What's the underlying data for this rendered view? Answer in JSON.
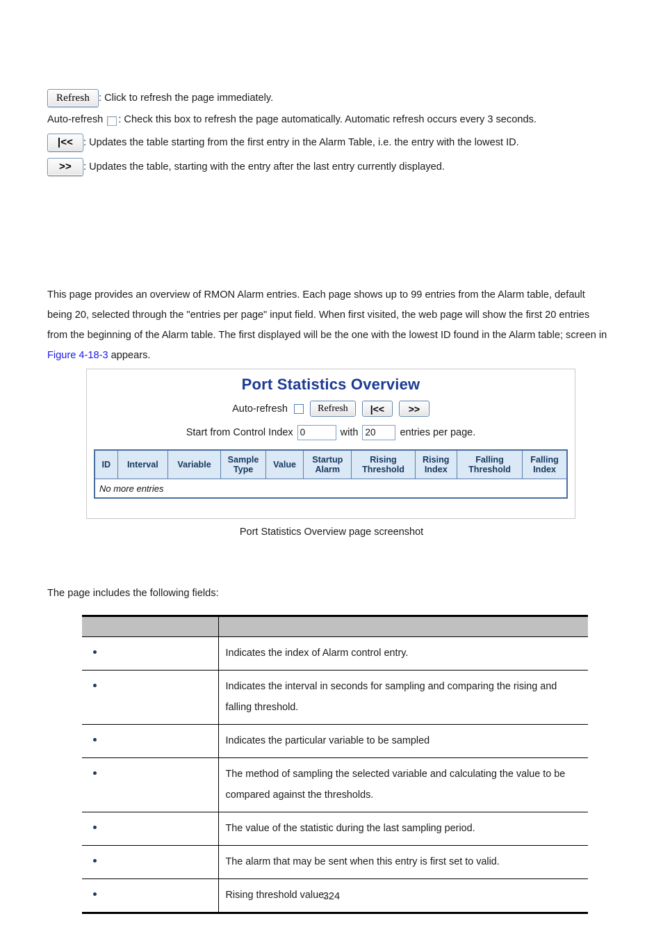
{
  "legend": {
    "refresh_button_label": "Refresh",
    "refresh_desc": ": Click to refresh the page immediately.",
    "autorefresh_label": "Auto-refresh",
    "autorefresh_desc": ": Check this box to refresh the page automatically. Automatic refresh occurs every 3 seconds.",
    "first_button_label": "|<<",
    "first_desc": ": Updates the table starting from the first entry in the Alarm Table, i.e. the entry with the lowest ID.",
    "next_button_label": ">>",
    "next_desc": ": Updates the table, starting with the entry after the last entry currently displayed."
  },
  "paragraph": {
    "part1": "This page provides an overview of RMON Alarm entries. Each page shows up to 99 entries from the Alarm table, default being 20, selected through the \"entries per page\" input field. When first visited, the web page will show the first 20 entries from the beginning of the Alarm table. The first displayed will be the one with the lowest ID found in the Alarm table; screen in ",
    "link": "Figure 4-18-3",
    "part2": " appears."
  },
  "screenshot": {
    "title": "Port Statistics Overview",
    "autorefresh_label": "Auto-refresh",
    "refresh_button": "Refresh",
    "first_button": "|<<",
    "next_button": ">>",
    "start_label": "Start from Control Index",
    "start_value": "0",
    "with_label": "with",
    "entries_value": "20",
    "entries_label": "entries per page.",
    "columns": [
      "ID",
      "Interval",
      "Variable",
      "Sample Type",
      "Value",
      "Startup Alarm",
      "Rising Threshold",
      "Rising Index",
      "Falling Threshold",
      "Falling Index"
    ],
    "empty_row_text": "No more entries"
  },
  "caption": "Port Statistics Overview page screenshot",
  "fields_intro": "The page includes the following fields:",
  "fields_table": {
    "header": [
      "",
      ""
    ],
    "rows": [
      {
        "name": "",
        "description": "Indicates the index of Alarm control entry."
      },
      {
        "name": "",
        "description": "Indicates the interval in seconds for sampling and comparing the rising and falling threshold."
      },
      {
        "name": "",
        "description": "Indicates the particular variable to be sampled"
      },
      {
        "name": "",
        "description": "The method of sampling the selected variable and calculating the value to be compared against the thresholds."
      },
      {
        "name": "",
        "description": "The value of the statistic during the last sampling period."
      },
      {
        "name": "",
        "description": "The alarm that may be sent when this entry is first set to valid."
      },
      {
        "name": "",
        "description": "Rising threshold value."
      }
    ]
  },
  "page_number": "324",
  "colors": {
    "link": "#1a1aee",
    "screenshot_title": "#1b3a93",
    "table_header_bg": "#dbe8f6",
    "fields_header_bg": "#c0c0c0",
    "bullet": "#1f3a5f"
  }
}
